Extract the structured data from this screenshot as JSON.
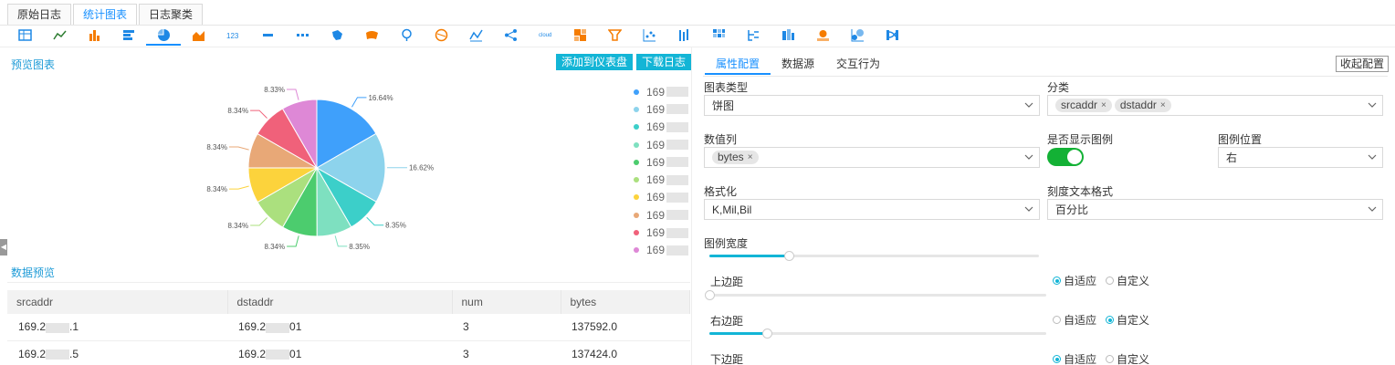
{
  "tabs": [
    {
      "label": "原始日志",
      "active": false
    },
    {
      "label": "统计图表",
      "active": true
    },
    {
      "label": "日志聚类",
      "active": false
    }
  ],
  "toolbar": {
    "icons": [
      "table-chart-icon",
      "line-chart-icon",
      "bar-chart-icon",
      "horizontal-bar-icon",
      "pie-chart-icon",
      "area-chart-icon",
      "number-chart-icon",
      "single-value-icon",
      "multi-value-icon",
      "map-china-icon",
      "map-world-icon",
      "map-pin-icon",
      "map-globe-icon",
      "radar-chart-icon",
      "flow-chart-icon",
      "word-cloud-icon",
      "treemap-icon",
      "funnel-chart-icon",
      "scatter-chart-icon",
      "candlestick-icon",
      "heatmap-icon",
      "tree-icon",
      "sunburst-icon",
      "gauge-icon",
      "bubble-icon",
      "sankey-icon"
    ],
    "active_index": 4,
    "accent": "#1890ff"
  },
  "preview": {
    "title": "预览图表",
    "add_dashboard": "添加到仪表盘",
    "download_log": "下载日志"
  },
  "chart_data": {
    "type": "pie",
    "slices": [
      {
        "label": "16.64%",
        "value": 16.64,
        "color": "#3fa0fb"
      },
      {
        "label": "16.62%",
        "value": 16.62,
        "color": "#8dd3ec"
      },
      {
        "label": "8.35%",
        "value": 8.35,
        "color": "#3ccfc9"
      },
      {
        "label": "8.35%",
        "value": 8.35,
        "color": "#7ee0c0"
      },
      {
        "label": "8.34%",
        "value": 8.34,
        "color": "#4ccc6e"
      },
      {
        "label": "8.34%",
        "value": 8.34,
        "color": "#abe07e"
      },
      {
        "label": "8.34%",
        "value": 8.34,
        "color": "#fcd33c"
      },
      {
        "label": "8.34%",
        "value": 8.34,
        "color": "#e8a877"
      },
      {
        "label": "8.34%",
        "value": 8.34,
        "color": "#f0617a"
      },
      {
        "label": "8.33%",
        "value": 8.33,
        "color": "#de88d6"
      }
    ],
    "legend_placement": "right",
    "legend": [
      "169",
      "169",
      "169",
      "169",
      "169",
      "169",
      "169",
      "169",
      "169",
      "169"
    ]
  },
  "data_preview": {
    "title": "数据预览",
    "columns": [
      "srcaddr",
      "dstaddr",
      "num",
      "bytes"
    ],
    "rows": [
      {
        "src_pre": "169.2",
        "src_suf": ".1",
        "dst_pre": "169.2",
        "dst_suf": "01",
        "num": "3",
        "bytes": "137592.0"
      },
      {
        "src_pre": "169.2",
        "src_suf": ".5",
        "dst_pre": "169.2",
        "dst_suf": "01",
        "num": "3",
        "bytes": "137424.0"
      }
    ]
  },
  "config": {
    "tabs": [
      "属性配置",
      "数据源",
      "交互行为"
    ],
    "collapse": "收起配置",
    "chart_type_label": "图表类型",
    "chart_type_value": "饼图",
    "category_label": "分类",
    "category_tags": [
      "srcaddr",
      "dstaddr"
    ],
    "value_label": "数值列",
    "value_tags": [
      "bytes"
    ],
    "show_legend_label": "是否显示图例",
    "show_legend": true,
    "legend_pos_label": "图例位置",
    "legend_pos_value": "右",
    "format_label": "格式化",
    "format_value": "K,Mil,Bil",
    "tick_format_label": "刻度文本格式",
    "tick_format_value": "百分比",
    "legend_width_label": "图例宽度",
    "legend_width_fraction": 0.24,
    "top_margin_label": "上边距",
    "top_margin_fraction": 0.0,
    "right_margin_label": "右边距",
    "right_margin_fraction": 0.17,
    "bottom_margin_label": "下边距",
    "auto_label": "自适应",
    "custom_label": "自定义"
  }
}
